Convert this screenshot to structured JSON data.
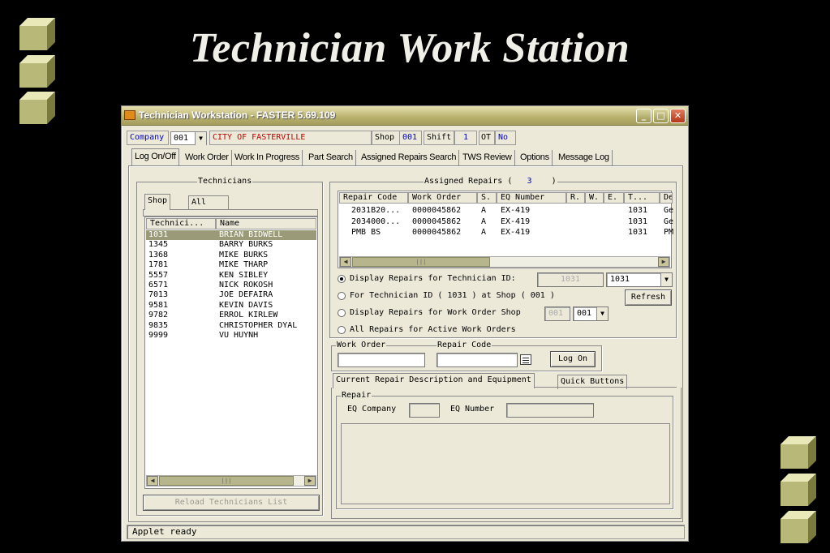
{
  "slide": {
    "title": "Technician Work Station"
  },
  "window": {
    "title": "Technician Workstation - FASTER 5.69.109"
  },
  "topbar": {
    "company_label": "Company",
    "company_value": "001",
    "company_name": "CITY OF FASTERVILLE",
    "shop_label": "Shop",
    "shop_value": "001",
    "shift_label": "Shift",
    "shift_value": "1",
    "ot_label": "OT",
    "ot_value": "No"
  },
  "tabs": [
    "Log On/Off",
    "Work Order",
    "Work In Progress",
    "Part Search",
    "Assigned Repairs Search",
    "TWS Review",
    "Options",
    "Message Log"
  ],
  "technicians": {
    "legend": "Technicians",
    "filter_tabs": [
      "Shop",
      "All"
    ],
    "columns": [
      "Technici...",
      "Name"
    ],
    "rows": [
      {
        "id": "1031",
        "name": "BRIAN BIDWELL"
      },
      {
        "id": "1345",
        "name": "BARRY BURKS"
      },
      {
        "id": "1368",
        "name": "MIKE BURKS"
      },
      {
        "id": "1781",
        "name": "MIKE THARP"
      },
      {
        "id": "5557",
        "name": "KEN SIBLEY"
      },
      {
        "id": "6571",
        "name": "NICK ROKOSH"
      },
      {
        "id": "7013",
        "name": "JOE DEFAIRA"
      },
      {
        "id": "9581",
        "name": "KEVIN DAVIS"
      },
      {
        "id": "9782",
        "name": "ERROL KIRLEW"
      },
      {
        "id": "9835",
        "name": "CHRISTOPHER DYAL"
      },
      {
        "id": "9999",
        "name": "VU HUYNH"
      }
    ],
    "reload_button": "Reload Technicians List"
  },
  "assigned": {
    "legend_prefix": "Assigned Repairs (",
    "count": "3",
    "legend_suffix": ")",
    "columns": [
      "Repair Code",
      "Work Order",
      "S.",
      "EQ Number",
      "R.",
      "W.",
      "E.",
      "T...",
      "De"
    ],
    "rows": [
      [
        "2031B20...",
        "0000045862",
        "A",
        "EX-419",
        "",
        "",
        "",
        "1031",
        "Ge"
      ],
      [
        "2034000...",
        "0000045862",
        "A",
        "EX-419",
        "",
        "",
        "",
        "1031",
        "Ge"
      ],
      [
        "PMB BS",
        "0000045862",
        "A",
        "EX-419",
        "",
        "",
        "",
        "1031",
        "PM"
      ]
    ]
  },
  "options": {
    "opt1": "Display Repairs for Technician ID:",
    "opt1_field": "1031",
    "opt1_select": "1031",
    "opt2": "For Technician ID ( 1031 ) at Shop ( 001 )",
    "refresh_button": "Refresh",
    "opt3": "Display Repairs for Work Order Shop",
    "opt3_field": "001",
    "opt3_select": "001",
    "opt4": "All Repairs for Active Work Orders"
  },
  "logon": {
    "work_order_label": "Work Order",
    "repair_code_label": "Repair Code",
    "logon_button": "Log On"
  },
  "subtabs": [
    "Current Repair Description and Equipment",
    "Quick Buttons"
  ],
  "repair": {
    "legend": "Repair",
    "eq_company_label": "EQ Company",
    "eq_number_label": "EQ Number"
  },
  "status": "Applet ready"
}
